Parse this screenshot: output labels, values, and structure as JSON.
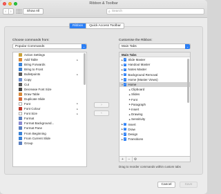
{
  "window": {
    "title": "Ribbon & Toolbar"
  },
  "toolbar": {
    "back": "‹",
    "forward": "›",
    "show_all": "Show All",
    "search_placeholder": "Search"
  },
  "tabs": [
    {
      "label": "Ribbon",
      "active": true
    },
    {
      "label": "Quick Access Toolbar",
      "active": false
    }
  ],
  "left": {
    "label": "Choose commands from:",
    "selected": "Popular Commands",
    "commands": [
      {
        "label": "Action Settings",
        "icon": "action-settings-icon",
        "color": "#c9a23a",
        "submenu": false
      },
      {
        "label": "Add Table",
        "icon": "table-icon",
        "color": "#d88a3a",
        "submenu": true
      },
      {
        "label": "Bring Forwards",
        "icon": "bring-forward-icon",
        "color": "#3b82d6",
        "submenu": false
      },
      {
        "label": "Bring to Front",
        "icon": "bring-front-icon",
        "color": "#3b82d6",
        "submenu": false
      },
      {
        "label": "Bulletpoints",
        "icon": "bullets-icon",
        "color": "#5a5a5a",
        "submenu": true
      },
      {
        "label": "Copy",
        "icon": "copy-icon",
        "color": "#6a8fd0",
        "submenu": false
      },
      {
        "label": "Cut",
        "icon": "cut-icon",
        "color": "#5a5a5a",
        "submenu": false
      },
      {
        "label": "Decrease Font Size",
        "icon": "decrease-font-icon",
        "color": "#4a4a4a",
        "submenu": false
      },
      {
        "label": "Draw Table",
        "icon": "draw-table-icon",
        "color": "#d88a3a",
        "submenu": false
      },
      {
        "label": "Duplicate Slide",
        "icon": "duplicate-slide-icon",
        "color": "#d46a3a",
        "submenu": false
      },
      {
        "label": "Font",
        "icon": "font-icon",
        "color": "#ffffff",
        "submenu": true
      },
      {
        "label": "Font Colour",
        "icon": "font-colour-icon",
        "color": "#c0392b",
        "submenu": true
      },
      {
        "label": "Font Size",
        "icon": "font-size-icon",
        "color": "#ffffff",
        "submenu": true
      },
      {
        "label": "Format",
        "icon": "format-icon",
        "color": "#5a7fc0",
        "submenu": false
      },
      {
        "label": "Format Background...",
        "icon": "format-background-icon",
        "color": "#8a8ad0",
        "submenu": false
      },
      {
        "label": "Format Pane",
        "icon": "format-pane-icon",
        "color": "#5a7fc0",
        "submenu": false
      },
      {
        "label": "From Beginning",
        "icon": "from-beginning-icon",
        "color": "#3b82d6",
        "submenu": false
      },
      {
        "label": "From Current Slide",
        "icon": "from-current-icon",
        "color": "#3b82d6",
        "submenu": false
      },
      {
        "label": "Group",
        "icon": "group-icon",
        "color": "#5a7fc0",
        "submenu": false
      }
    ]
  },
  "right": {
    "label": "Customise the Ribbon:",
    "selected": "Main Tabs",
    "header": "Main Tabs",
    "items": [
      {
        "label": "Slide Master",
        "level": 0,
        "expanded": false,
        "checked": true,
        "selected": false
      },
      {
        "label": "Handout Master",
        "level": 0,
        "expanded": false,
        "checked": true,
        "selected": false
      },
      {
        "label": "Notes Master",
        "level": 0,
        "expanded": false,
        "checked": true,
        "selected": false
      },
      {
        "label": "Background Removal",
        "level": 0,
        "expanded": false,
        "checked": true,
        "selected": false
      },
      {
        "label": "Home (Master Views)",
        "level": 0,
        "expanded": false,
        "checked": true,
        "selected": false
      },
      {
        "label": "Home",
        "level": 0,
        "expanded": true,
        "checked": true,
        "selected": true
      },
      {
        "label": "Clipboard",
        "level": 1,
        "expanded": false,
        "checked": false,
        "selected": false
      },
      {
        "label": "Slides",
        "level": 1,
        "expanded": false,
        "checked": false,
        "selected": false
      },
      {
        "label": "Font",
        "level": 1,
        "expanded": false,
        "checked": false,
        "selected": false
      },
      {
        "label": "Paragraph",
        "level": 1,
        "expanded": false,
        "checked": false,
        "selected": false
      },
      {
        "label": "Insert",
        "level": 1,
        "expanded": false,
        "checked": false,
        "selected": false
      },
      {
        "label": "Drawing",
        "level": 1,
        "expanded": false,
        "checked": false,
        "selected": false
      },
      {
        "label": "Sensitivity",
        "level": 1,
        "expanded": false,
        "checked": false,
        "selected": false
      },
      {
        "label": "Insert",
        "level": 0,
        "expanded": false,
        "checked": true,
        "selected": false
      },
      {
        "label": "Draw",
        "level": 0,
        "expanded": false,
        "checked": true,
        "selected": false
      },
      {
        "label": "Design",
        "level": 0,
        "expanded": false,
        "checked": true,
        "selected": false
      },
      {
        "label": "Transitions",
        "level": 0,
        "expanded": false,
        "checked": true,
        "selected": false
      }
    ],
    "bottom_buttons": [
      "+",
      "−",
      "⚙"
    ],
    "hint": "Drag to reorder commands within custom tabs"
  },
  "move": {
    "add": "›",
    "remove": "‹"
  },
  "footer": {
    "cancel": "Cancel",
    "save": "Save"
  }
}
